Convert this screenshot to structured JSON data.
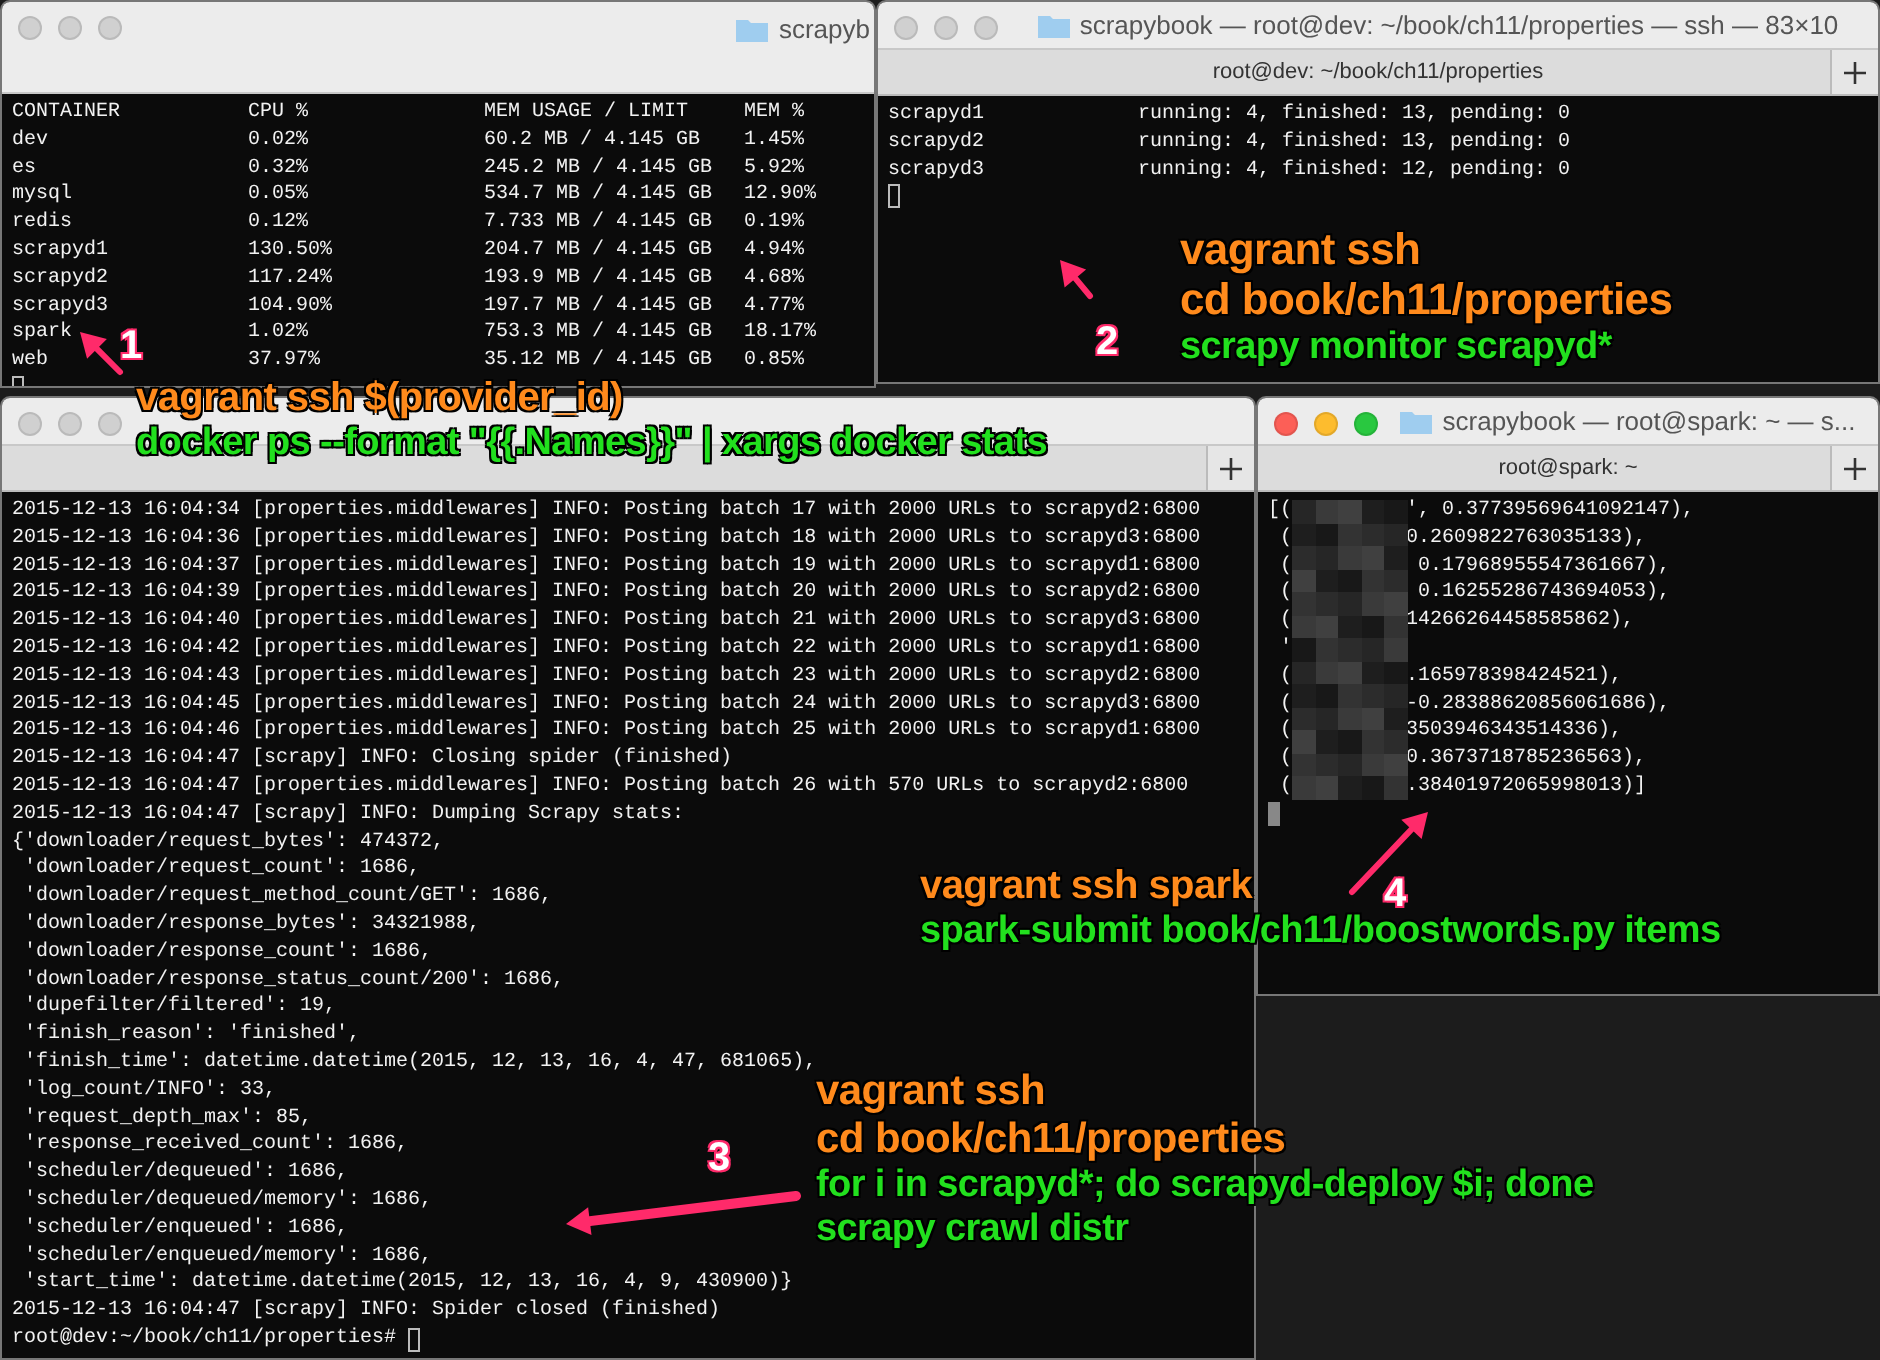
{
  "windows": [
    {
      "kind": "stats",
      "title": "scrapyb",
      "active": false,
      "columns": [
        "CONTAINER",
        "CPU %",
        "MEM USAGE / LIMIT",
        "MEM %"
      ],
      "rows": [
        [
          "dev",
          "0.02%",
          "60.2 MB / 4.145 GB",
          "1.45%"
        ],
        [
          "es",
          "0.32%",
          "245.2 MB / 4.145 GB",
          "5.92%"
        ],
        [
          "mysql",
          "0.05%",
          "534.7 MB / 4.145 GB",
          "12.90%"
        ],
        [
          "redis",
          "0.12%",
          "7.733 MB / 4.145 GB",
          "0.19%"
        ],
        [
          "scrapyd1",
          "130.50%",
          "204.7 MB / 4.145 GB",
          "4.94%"
        ],
        [
          "scrapyd2",
          "117.24%",
          "193.9 MB / 4.145 GB",
          "4.68%"
        ],
        [
          "scrapyd3",
          "104.90%",
          "197.7 MB / 4.145 GB",
          "4.77%"
        ],
        [
          "spark",
          "1.02%",
          "753.3 MB / 4.145 GB",
          "18.17%"
        ],
        [
          "web",
          "37.97%",
          "35.12 MB / 4.145 GB",
          "0.85%"
        ]
      ]
    },
    {
      "kind": "monitor",
      "title": "scrapybook — root@dev: ~/book/ch11/properties — ssh — 83×10",
      "tab": "root@dev: ~/book/ch11/properties",
      "active": false,
      "rows": [
        [
          "scrapyd1",
          "running: 4, finished: 13, pending: 0"
        ],
        [
          "scrapyd2",
          "running: 4, finished: 13, pending: 0"
        ],
        [
          "scrapyd3",
          "running: 4, finished: 12, pending: 0"
        ]
      ]
    },
    {
      "kind": "log",
      "active": false,
      "lines": [
        "2015-12-13 16:04:34 [properties.middlewares] INFO: Posting batch 17 with 2000 URLs to scrapyd2:6800",
        "2015-12-13 16:04:36 [properties.middlewares] INFO: Posting batch 18 with 2000 URLs to scrapyd3:6800",
        "2015-12-13 16:04:37 [properties.middlewares] INFO: Posting batch 19 with 2000 URLs to scrapyd1:6800",
        "2015-12-13 16:04:39 [properties.middlewares] INFO: Posting batch 20 with 2000 URLs to scrapyd2:6800",
        "2015-12-13 16:04:40 [properties.middlewares] INFO: Posting batch 21 with 2000 URLs to scrapyd3:6800",
        "2015-12-13 16:04:42 [properties.middlewares] INFO: Posting batch 22 with 2000 URLs to scrapyd1:6800",
        "2015-12-13 16:04:43 [properties.middlewares] INFO: Posting batch 23 with 2000 URLs to scrapyd2:6800",
        "2015-12-13 16:04:45 [properties.middlewares] INFO: Posting batch 24 with 2000 URLs to scrapyd3:6800",
        "2015-12-13 16:04:46 [properties.middlewares] INFO: Posting batch 25 with 2000 URLs to scrapyd1:6800",
        "2015-12-13 16:04:47 [scrapy] INFO: Closing spider (finished)",
        "2015-12-13 16:04:47 [properties.middlewares] INFO: Posting batch 26 with 570 URLs to scrapyd2:6800",
        "2015-12-13 16:04:47 [scrapy] INFO: Dumping Scrapy stats:",
        "{'downloader/request_bytes': 474372,",
        " 'downloader/request_count': 1686,",
        " 'downloader/request_method_count/GET': 1686,",
        " 'downloader/response_bytes': 34321988,",
        " 'downloader/response_count': 1686,",
        " 'downloader/response_status_count/200': 1686,",
        " 'dupefilter/filtered': 19,",
        " 'finish_reason': 'finished',",
        " 'finish_time': datetime.datetime(2015, 12, 13, 16, 4, 47, 681065),",
        " 'log_count/INFO': 33,",
        " 'request_depth_max': 85,",
        " 'response_received_count': 1686,",
        " 'scheduler/dequeued': 1686,",
        " 'scheduler/dequeued/memory': 1686,",
        " 'scheduler/enqueued': 1686,",
        " 'scheduler/enqueued/memory': 1686,",
        " 'start_time': datetime.datetime(2015, 12, 13, 16, 4, 9, 430900)}",
        "2015-12-13 16:04:47 [scrapy] INFO: Spider closed (finished)"
      ],
      "prompt": "root@dev:~/book/ch11/properties# "
    },
    {
      "kind": "output",
      "title": "scrapybook — root@spark: ~ — s...",
      "tab": "root@spark: ~",
      "active": true,
      "lines": [
        [
          "[(",
          "', 0.37739569641092147),"
        ],
        [
          " (",
          "0.2609822763035133),"
        ],
        [
          " (",
          " 0.17968955547361667),"
        ],
        [
          " (",
          " 0.16255286743694053),"
        ],
        [
          " (",
          "14266264458585862),"
        ],
        [
          " '"
        ],
        [
          " (",
          ".165978398424521),"
        ],
        [
          " (",
          "-0.28388620856061686),"
        ],
        [
          " (",
          "3503946343514336),"
        ],
        [
          " (",
          "0.3673718785236563),"
        ],
        [
          " (",
          ".38401972065998013)]"
        ]
      ]
    }
  ],
  "annotations": [
    {
      "number": "1",
      "lines": [
        {
          "text": "vagrant ssh $(provider_id)",
          "color": "#ff8a1c"
        },
        {
          "text": "docker ps --format \"{{.Names}}\" | xargs docker stats",
          "color": "#22e01e"
        }
      ]
    },
    {
      "number": "2",
      "lines": [
        {
          "text": "vagrant ssh",
          "color": "#ff8a1c"
        },
        {
          "text": "cd book/ch11/properties",
          "color": "#ff8a1c"
        },
        {
          "text": "scrapy monitor scrapyd*",
          "color": "#22e01e"
        }
      ]
    },
    {
      "number": "3",
      "lines": [
        {
          "text": "vagrant ssh",
          "color": "#ff8a1c"
        },
        {
          "text": "cd book/ch11/properties",
          "color": "#ff8a1c"
        },
        {
          "text": "for i in scrapyd*; do scrapyd-deploy $i; done",
          "color": "#22e01e"
        },
        {
          "text": "scrapy crawl distr",
          "color": "#22e01e"
        }
      ]
    },
    {
      "number": "4",
      "lines": [
        {
          "text": "vagrant ssh spark",
          "color": "#ff8a1c"
        },
        {
          "text": "spark-submit book/ch11/boostwords.py items",
          "color": "#22e01e"
        }
      ]
    }
  ]
}
